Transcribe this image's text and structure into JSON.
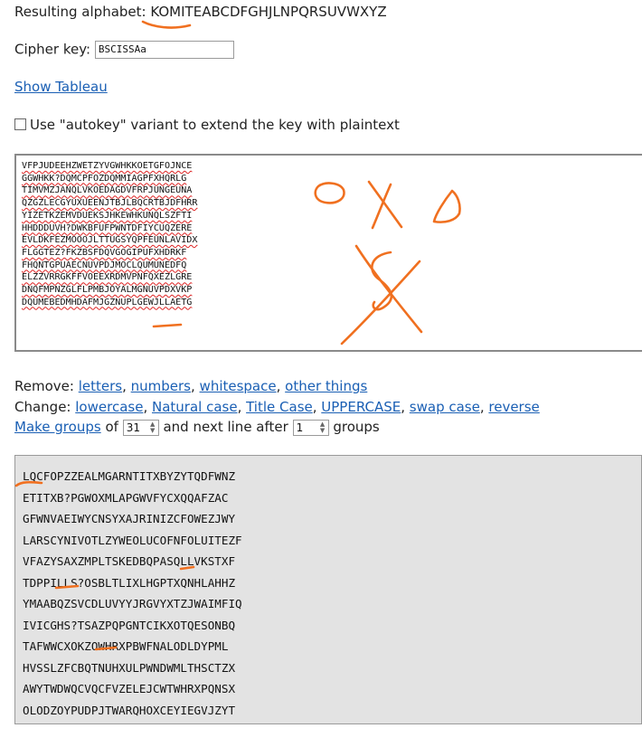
{
  "alphabet": {
    "label": "Resulting alphabet:",
    "value": "KOMITEABCDFGHJLNPQRSUVWXYZ"
  },
  "cipher_key": {
    "label": "Cipher key:",
    "value": "BSCISSAa"
  },
  "show_tableau": "Show Tableau",
  "autokey": {
    "label": "Use \"autokey\" variant to extend the key with plaintext"
  },
  "input_lines": [
    "VFPJUDEEHZWETZYVGWHKKOETGFOJNCE",
    "GGWHKK?DQMCPFOZDQMMIAGPFXHQRLG",
    "TIMVMZJANQLVKOEDAGDVFRPJUNGEUNA",
    "QZGZLECGYUXUEENJTBJLBQCRTBJDFHRR",
    "YIZETKZEMVDUEKSJHKEWHKUNQLSZFTI",
    "HHDDDUVH?DWKBFUFPWNTDFIYCUQZERE",
    "EVLDKFEZMOOOJLTTUGSYQPFEUNLAVIDX",
    "FLGGTEZ?FKZBSFDQVGOGIPUFXHDRKF",
    "FHQNTGPUAECNUVPDJMOCLQUMUNEDFQ",
    "ELZZVRRGKFFVOEEXRDMVPNFQXEZLGRE",
    "DNQFMPNZGLFLPMBJOYALMGNUVPDXVKP",
    "DQUMEBEDMHDAFMJGZNUPLGEWJLLAETG"
  ],
  "remove": {
    "label": "Remove:",
    "links": [
      "letters",
      "numbers",
      "whitespace",
      "other things"
    ]
  },
  "change": {
    "label": "Change:",
    "links": [
      "lowercase",
      "Natural case",
      "Title Case",
      "UPPERCASE",
      "swap case",
      "reverse"
    ]
  },
  "groups": {
    "make_groups": "Make groups",
    "of": "of",
    "group_size": "31",
    "next_line": "and next line after",
    "line_after": "1",
    "groups_word": "groups"
  },
  "output_lines": [
    "LQCFOPZZEALMGARNTITXBYZYTQDFWNZ",
    "ETITXB?PGWOXMLAPGWVFYCXQQAFZAC",
    "GFWNVAEIWYCNSYXAJRINIZCFOWEZJWY",
    "LARSCYNIVOTLZYWEOLUCOFNFOLUITEZF",
    "VFAZYSAXZMPLTSKEDBQPASQLLVKSTXF",
    "TDPPILLS?OSBLTLIXLHGPTXQNHLAHHZ",
    "YMAABQZSVCDLUVYYJRGVYXTZJWAIMFIQ",
    "IVICGHS?TSAZPQPGNTCIKXOTQESONBQ",
    "TAFWWCXOKZOWHRXPBWFNALODLDYPML",
    "HVSSLZFCBQTNUHXULPWNDWMLTHSCTZX",
    "AWYTWDWQCVQCFVZELEJCWTWHRXPQNSX",
    "OLODZOYPUDPJTWARQHOXCEYIEGVJZYT"
  ],
  "annotation_color": "#f07020"
}
